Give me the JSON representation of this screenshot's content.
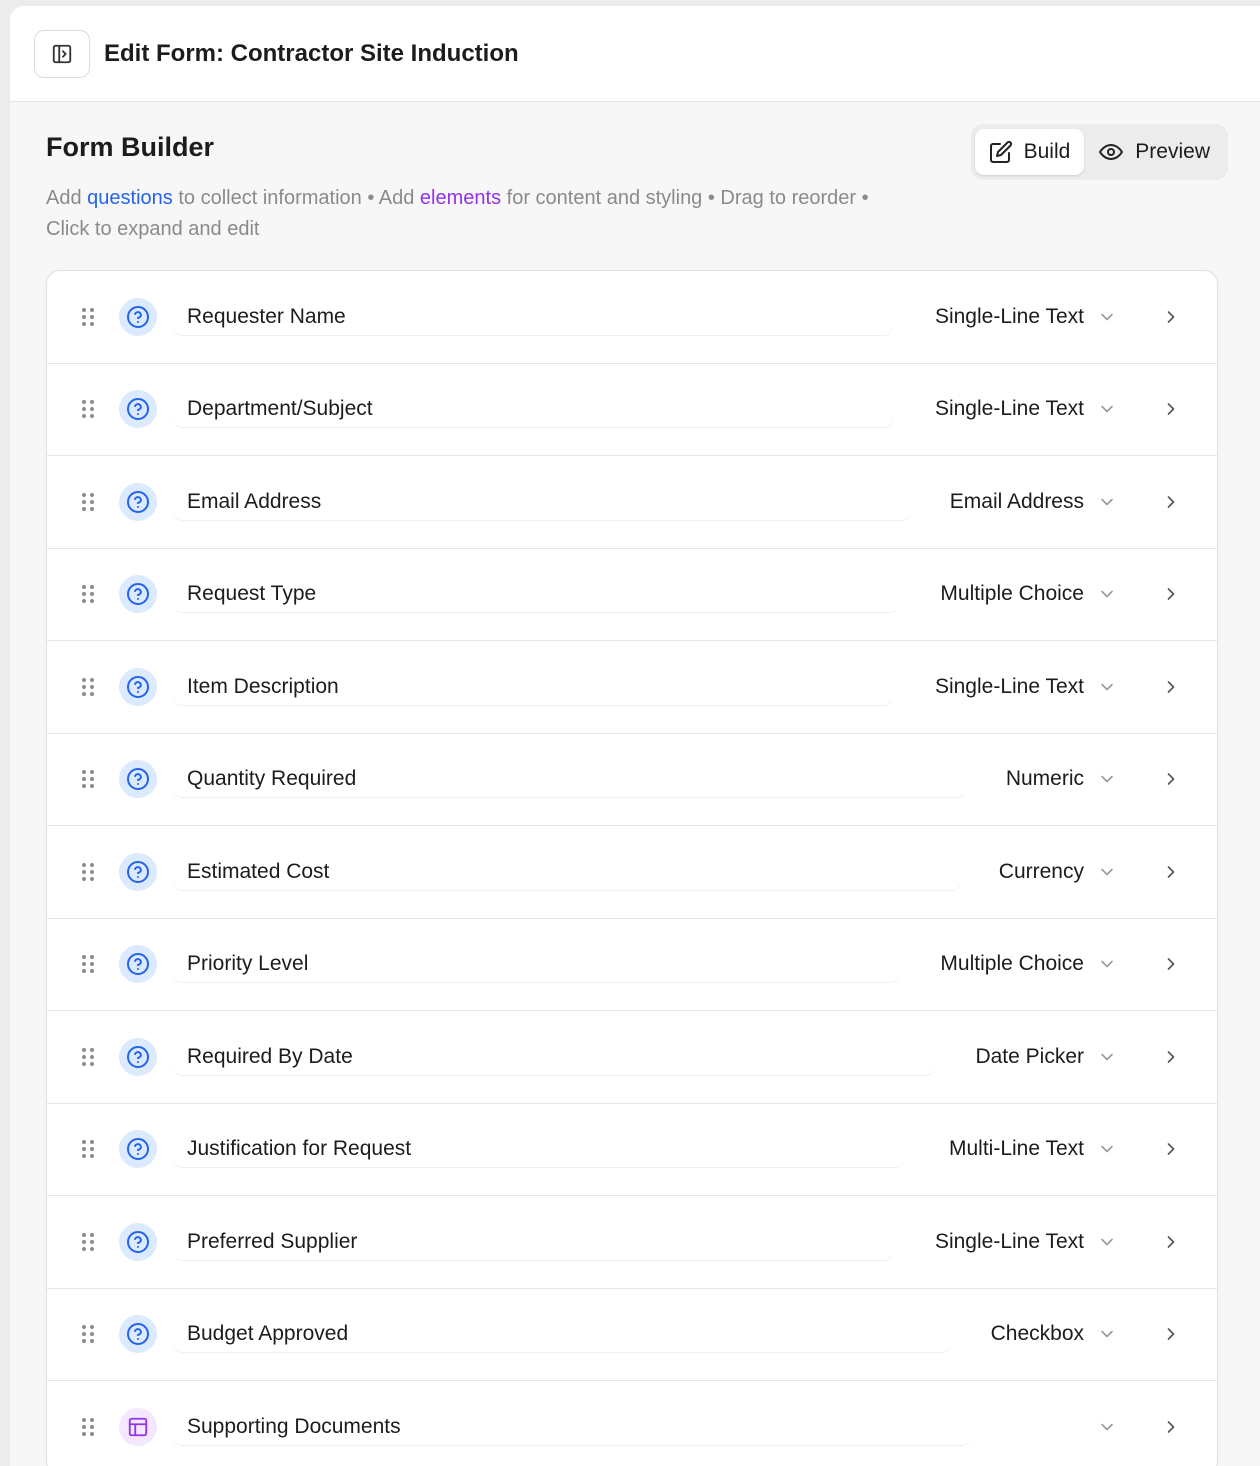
{
  "header": {
    "title": "Edit Form: Contractor Site Induction"
  },
  "builder": {
    "title": "Form Builder",
    "desc": {
      "part1": "Add ",
      "questions_link": "questions",
      "part2": " to collect information • Add ",
      "elements_link": "elements",
      "part3": " for content and styling • Drag to reorder • Click to expand and edit"
    },
    "modes": {
      "build": "Build",
      "preview": "Preview",
      "active": "Build"
    }
  },
  "colors": {
    "question_accent": "#2563eb",
    "element_accent": "#9333ea"
  },
  "items": [
    {
      "label": "Requester Name",
      "type": "Single-Line Text",
      "kind": "question",
      "icon": "help-circle-icon"
    },
    {
      "label": "Department/Subject",
      "type": "Single-Line Text",
      "kind": "question",
      "icon": "help-circle-icon"
    },
    {
      "label": "Email Address",
      "type": "Email Address",
      "kind": "question",
      "icon": "help-circle-icon"
    },
    {
      "label": "Request Type",
      "type": "Multiple Choice",
      "kind": "question",
      "icon": "help-circle-icon"
    },
    {
      "label": "Item Description",
      "type": "Single-Line Text",
      "kind": "question",
      "icon": "help-circle-icon"
    },
    {
      "label": "Quantity Required",
      "type": "Numeric",
      "kind": "question",
      "icon": "help-circle-icon"
    },
    {
      "label": "Estimated Cost",
      "type": "Currency",
      "kind": "question",
      "icon": "help-circle-icon"
    },
    {
      "label": "Priority Level",
      "type": "Multiple Choice",
      "kind": "question",
      "icon": "help-circle-icon"
    },
    {
      "label": "Required By Date",
      "type": "Date Picker",
      "kind": "question",
      "icon": "help-circle-icon"
    },
    {
      "label": "Justification for Request",
      "type": "Multi-Line Text",
      "kind": "question",
      "icon": "help-circle-icon"
    },
    {
      "label": "Preferred Supplier",
      "type": "Single-Line Text",
      "kind": "question",
      "icon": "help-circle-icon"
    },
    {
      "label": "Budget Approved",
      "type": "Checkbox",
      "kind": "question",
      "icon": "help-circle-icon"
    },
    {
      "label": "Supporting Documents",
      "type": "",
      "kind": "element",
      "icon": "layout-icon"
    }
  ]
}
